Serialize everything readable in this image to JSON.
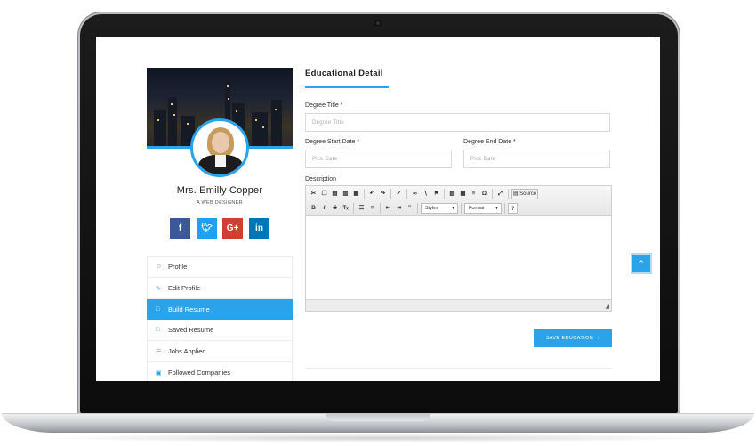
{
  "profile": {
    "name": "Mrs. Emilly Copper",
    "role": "A WEB DESIGNER",
    "social": [
      {
        "name": "facebook",
        "glyph": "f",
        "color": "#3b5998"
      },
      {
        "name": "twitter",
        "glyph": "❦",
        "color": "#1da1f2"
      },
      {
        "name": "google-plus",
        "glyph": "G+",
        "color": "#d23f31"
      },
      {
        "name": "linkedin",
        "glyph": "in",
        "color": "#0077b5"
      }
    ]
  },
  "sidebar": {
    "items": [
      {
        "label": "Profile",
        "icon": "user-icon",
        "glyph": "☺",
        "active": false
      },
      {
        "label": "Edit Profile",
        "icon": "edit-icon",
        "glyph": "✎",
        "active": false
      },
      {
        "label": "Build Resume",
        "icon": "file-icon",
        "glyph": "□",
        "active": true
      },
      {
        "label": "Saved Resume",
        "icon": "file-icon",
        "glyph": "□",
        "active": false
      },
      {
        "label": "Jobs Applied",
        "icon": "list-icon",
        "glyph": "☰",
        "active": false
      },
      {
        "label": "Followed Companies",
        "icon": "building-icon",
        "glyph": "▣",
        "active": false
      }
    ]
  },
  "form": {
    "title": "Educational Detail",
    "degree_title": {
      "label": "Degree Title *",
      "placeholder": "Degree Title"
    },
    "start_date": {
      "label": "Degree Start Date *",
      "placeholder": "Pick Date"
    },
    "end_date": {
      "label": "Degree End Date *",
      "placeholder": "Pick Date"
    },
    "description": {
      "label": "Description"
    },
    "editor": {
      "source_label": "Source",
      "styles_label": "Styles",
      "format_label": "Format"
    },
    "save_label": "SAVE EDUCATION"
  },
  "colors": {
    "accent": "#2aa3ea"
  }
}
